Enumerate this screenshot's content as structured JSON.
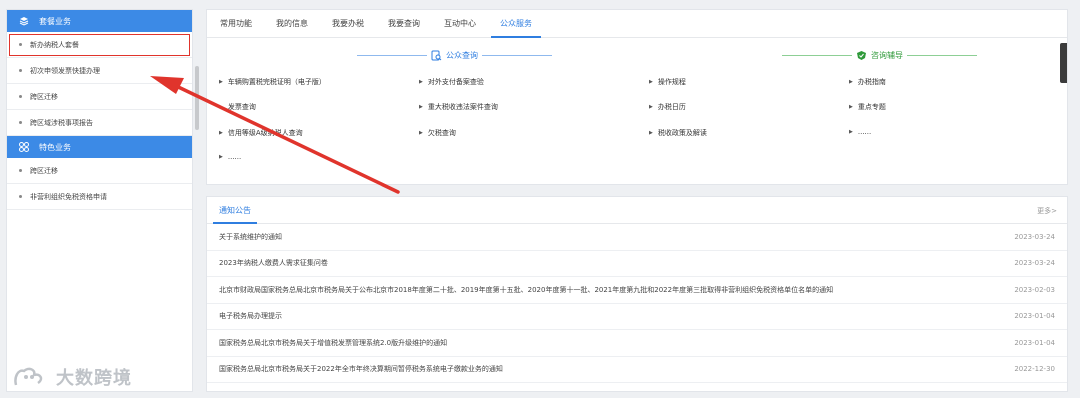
{
  "sidebar": {
    "sections": [
      {
        "title": "套餐业务",
        "icon": "layers-icon",
        "items": [
          "新办纳税人套餐",
          "初次申领发票快捷办理",
          "跨区迁移",
          "跨区域涉税事项报告"
        ]
      },
      {
        "title": "特色业务",
        "icon": "grid-icon",
        "items": [
          "跨区迁移",
          "非营利组织免税资格申请"
        ]
      }
    ]
  },
  "tabs": [
    "常用功能",
    "我的信息",
    "我要办税",
    "我要查询",
    "互动中心",
    "公众服务"
  ],
  "active_tab": "公众服务",
  "public_query": {
    "title": "公众查询",
    "icon": "search-doc-icon",
    "color": "#2f7ee0",
    "links": [
      "车辆购置税完税证明（电子版）",
      "对外支付备案查验",
      "发票查询",
      "重大税收违法案件查询",
      "信用等级A级纳税人查询",
      "欠税查询",
      "......"
    ]
  },
  "consult": {
    "title": "咨询辅导",
    "icon": "shield-icon",
    "color": "#2f9a3a",
    "links": [
      "操作规程",
      "办税指南",
      "办税日历",
      "重点专题",
      "税收政策及解读",
      "......"
    ]
  },
  "notices": {
    "title": "通知公告",
    "more": "更多>",
    "items": [
      {
        "text": "关于系统维护的通知",
        "date": "2023-03-24"
      },
      {
        "text": "2023年纳税人缴费人需求征集问卷",
        "date": "2023-03-24"
      },
      {
        "text": "北京市财政局国家税务总局北京市税务局关于公布北京市2018年度第二十批、2019年度第十五批、2020年度第十一批、2021年度第九批和2022年度第三批取得非营利组织免税资格单位名单的通知",
        "date": "2023-02-03"
      },
      {
        "text": "电子税务局办理提示",
        "date": "2023-01-04"
      },
      {
        "text": "国家税务总局北京市税务局关于增值税发票管理系统2.0版升级维护的通知",
        "date": "2023-01-04"
      },
      {
        "text": "国家税务总局北京市税务局关于2022年全市年终决算期间暂停税务系统电子缴款业务的通知",
        "date": "2022-12-30"
      }
    ]
  },
  "watermark": "大数跨境",
  "colors": {
    "accent": "#3c8ae6",
    "highlight": "#e0342c",
    "arrow": "#e0342c"
  }
}
